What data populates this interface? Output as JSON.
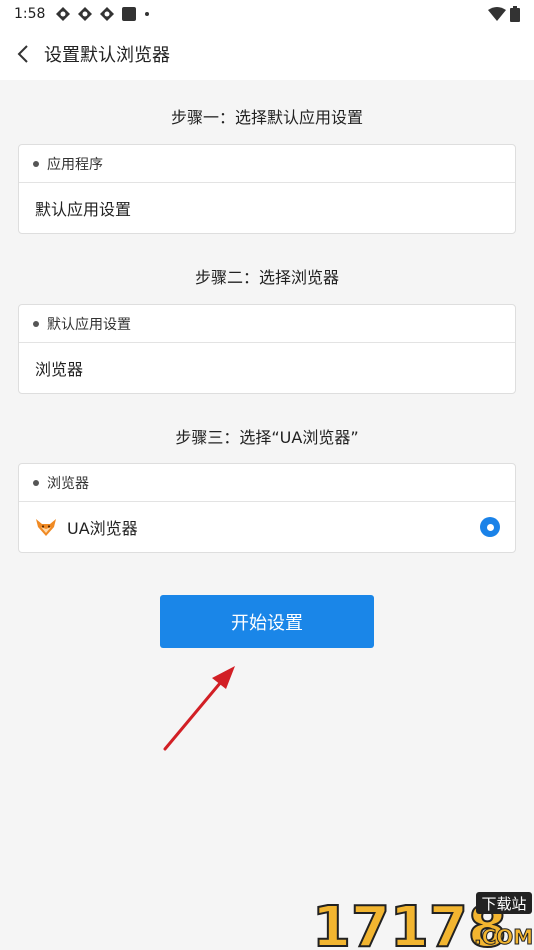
{
  "status_bar": {
    "time": "1:58"
  },
  "app_bar": {
    "title": "设置默认浏览器"
  },
  "steps": [
    {
      "title": "步骤一：选择默认应用设置",
      "header": "应用程序",
      "body": "默认应用设置"
    },
    {
      "title": "步骤二：选择浏览器",
      "header": "默认应用设置",
      "body": "浏览器"
    },
    {
      "title": "步骤三：选择“UA浏览器”",
      "header": "浏览器",
      "body": "UA浏览器"
    }
  ],
  "start_button": {
    "label": "开始设置"
  },
  "watermark": {
    "number": "17178",
    "tag": "下载站",
    "domain": ".COM"
  },
  "colors": {
    "accent": "#1a86e8",
    "arrow": "#d21f25",
    "fox": "#f08a24"
  },
  "icons": {
    "back": "chevron-left-icon",
    "status": [
      "app-icon",
      "app-icon",
      "app-icon",
      "square-icon"
    ],
    "wifi": "wifi-icon",
    "battery": "battery-icon",
    "fox": "ua-browser-fox-icon"
  }
}
